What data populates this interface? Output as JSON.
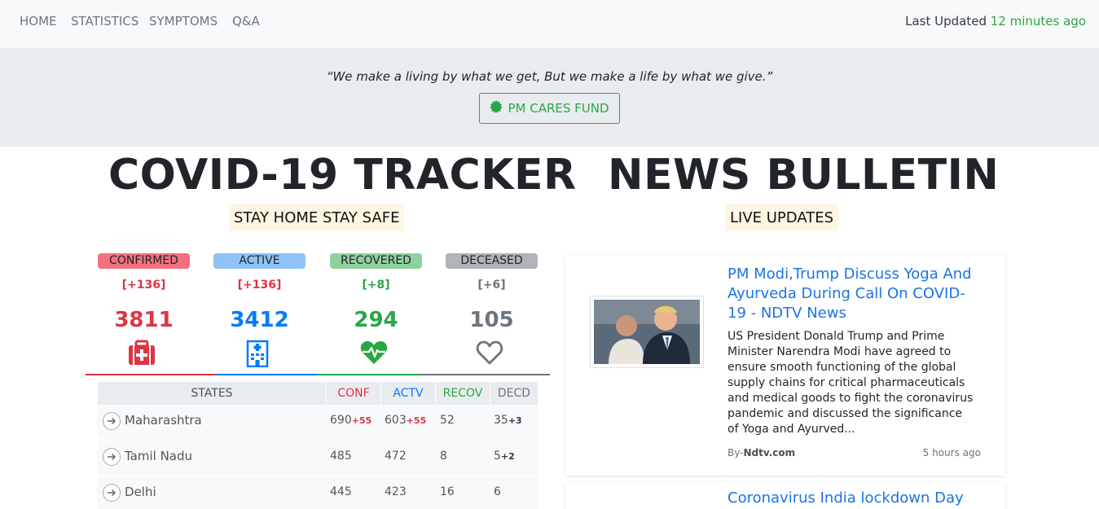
{
  "nav": {
    "links": [
      "HOME",
      "STATISTICS",
      "SYMPTOMS",
      "Q&A"
    ],
    "updated_label": "Last Updated",
    "updated_value": "12 minutes ago"
  },
  "banner": {
    "quote": "“We make a living by what we get, But we make a life by what we give.”",
    "button_label": "PM CARES FUND"
  },
  "tracker": {
    "title": "COVID-19 TRACKER",
    "subtitle": "STAY HOME STAY SAFE",
    "stats": [
      {
        "label": "CONFIRMED",
        "delta": "[+136]",
        "value": "3811",
        "color": "#dc3545",
        "bg": "#f5707e",
        "icon": "first-aid-kit-icon"
      },
      {
        "label": "ACTIVE",
        "delta": "[+136]",
        "value": "3412",
        "color": "#007bff",
        "bg": "#8fc3f5",
        "icon": "hospital-icon"
      },
      {
        "label": "RECOVERED",
        "delta": "[+8]",
        "value": "294",
        "color": "#28a745",
        "bg": "#8fd19e",
        "icon": "heartbeat-icon"
      },
      {
        "label": "DECEASED",
        "delta": "[+6]",
        "value": "105",
        "color": "#6c757d",
        "bg": "#b0b3b7",
        "icon": "heart-outline-icon"
      }
    ],
    "table": {
      "headers": [
        "STATES",
        "CONF",
        "ACTV",
        "RECOV",
        "DECD"
      ],
      "rows": [
        {
          "state": "Maharashtra",
          "conf": "690",
          "conf_plus": "+55",
          "actv": "603",
          "actv_plus": "+55",
          "recov": "52",
          "decd": "35",
          "decd_plus": "+3"
        },
        {
          "state": "Tamil Nadu",
          "conf": "485",
          "conf_plus": "",
          "actv": "472",
          "actv_plus": "",
          "recov": "8",
          "decd": "5",
          "decd_plus": "+2"
        },
        {
          "state": "Delhi",
          "conf": "445",
          "conf_plus": "",
          "actv": "423",
          "actv_plus": "",
          "recov": "16",
          "decd": "6",
          "decd_plus": ""
        }
      ]
    }
  },
  "news": {
    "title": "NEWS BULLETIN",
    "subtitle": "LIVE UPDATES",
    "items": [
      {
        "headline": "PM Modi,Trump Discuss Yoga And Ayurveda During Call On COVID-19 - NDTV News",
        "description": "US President Donald Trump and Prime Minister Narendra Modi have agreed to ensure smooth functioning of the global supply chains for critical pharmaceuticals and medical goods to fight the coronavirus pandemic and discussed the significance of Yoga and Ayurved...",
        "by_prefix": "By-",
        "source": "Ndtv.com",
        "time": "5 hours ago"
      },
      {
        "headline": "Coronavirus India lockdown Day"
      }
    ]
  }
}
